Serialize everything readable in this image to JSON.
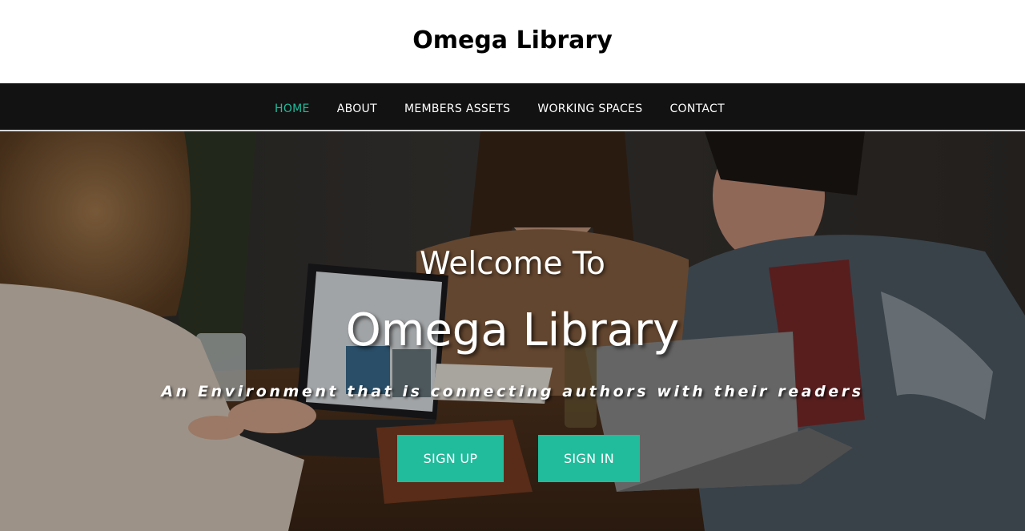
{
  "site": {
    "title": "Omega Library"
  },
  "nav": {
    "items": [
      {
        "label": "HOME",
        "active": true
      },
      {
        "label": "ABOUT",
        "active": false
      },
      {
        "label": "MEMBERS ASSETS",
        "active": false
      },
      {
        "label": "WORKING SPACES",
        "active": false
      },
      {
        "label": "CONTACT",
        "active": false
      }
    ]
  },
  "hero": {
    "kicker": "Welcome To",
    "title": "Omega Library",
    "tagline": "An Environment that is connecting authors with their readers",
    "buttons": {
      "signup": "SIGN UP",
      "signin": "SIGN IN"
    },
    "image": "people-working-with-laptops-photo"
  },
  "colors": {
    "accent": "#20bc9c",
    "navbar_bg": "#121212",
    "header_bg": "#ffffff"
  }
}
